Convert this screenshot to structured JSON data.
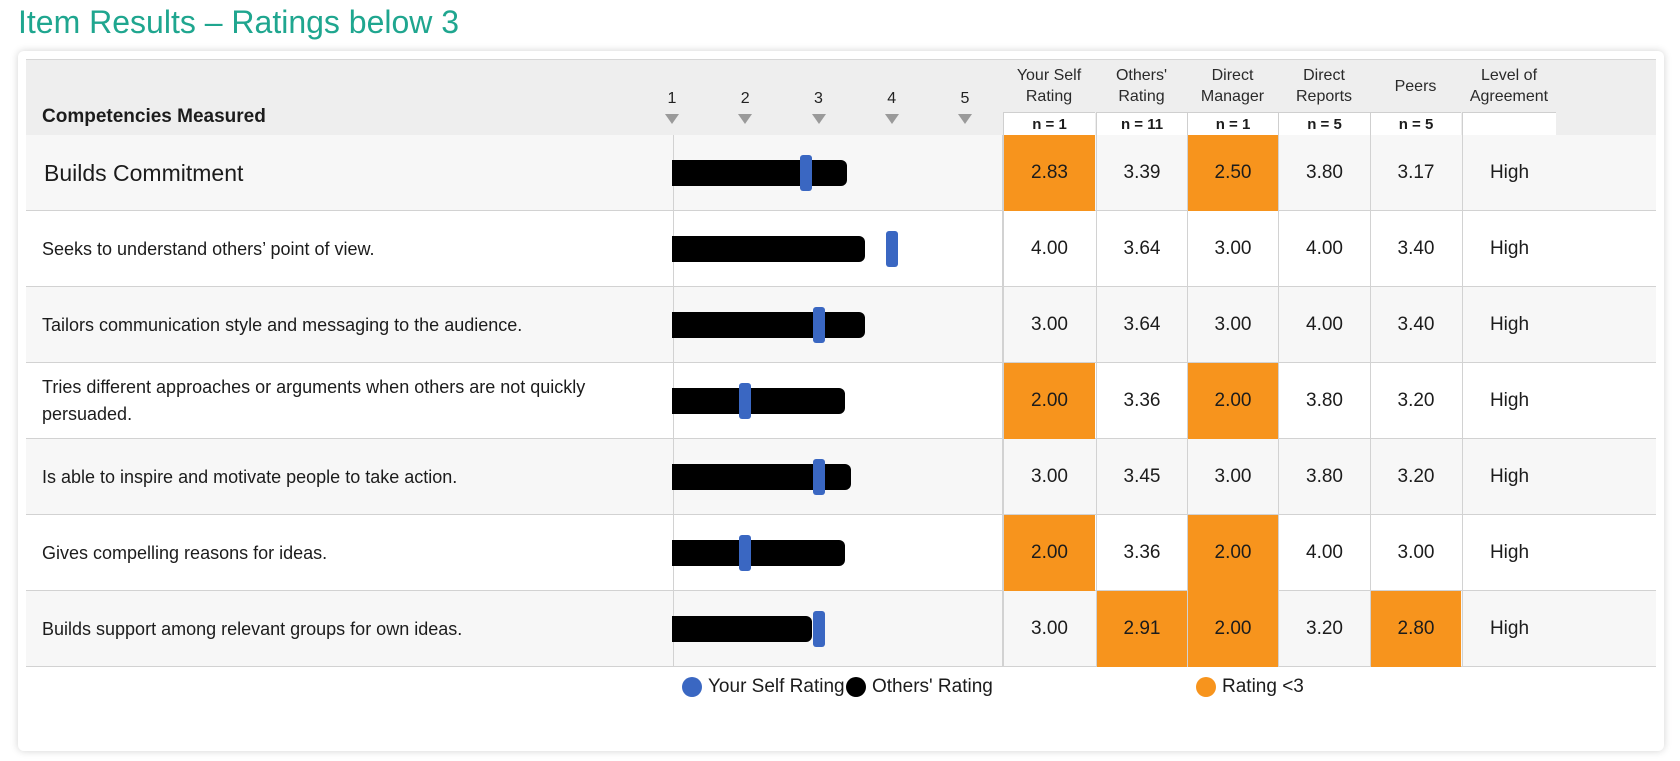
{
  "page": {
    "title": "Item Results – Ratings below 3"
  },
  "table": {
    "competency_header": "Competencies Measured",
    "scale": [
      "1",
      "2",
      "3",
      "4",
      "5"
    ],
    "columns": [
      {
        "key": "self",
        "label_lines": [
          "Your Self",
          "Rating"
        ],
        "n": "n = 1"
      },
      {
        "key": "others",
        "label_lines": [
          "Others'",
          "Rating"
        ],
        "n": "n = 11"
      },
      {
        "key": "manager",
        "label_lines": [
          "Direct",
          "Manager"
        ],
        "n": "n = 1"
      },
      {
        "key": "reports",
        "label_lines": [
          "Direct",
          "Reports"
        ],
        "n": "n = 5"
      },
      {
        "key": "peers",
        "label_lines": [
          "Peers"
        ],
        "n": "n = 5"
      },
      {
        "key": "agreement",
        "label_lines": [
          "Level of",
          "Agreement"
        ],
        "n": ""
      }
    ],
    "rows": [
      {
        "label": "Builds Commitment",
        "summary": true,
        "self": "2.83",
        "others": "3.39",
        "manager": "2.50",
        "reports": "3.80",
        "peers": "3.17",
        "agreement": "High"
      },
      {
        "label": "Seeks to understand others’ point of view.",
        "self": "4.00",
        "others": "3.64",
        "manager": "3.00",
        "reports": "4.00",
        "peers": "3.40",
        "agreement": "High"
      },
      {
        "label": "Tailors communication style and messaging to the audience.",
        "self": "3.00",
        "others": "3.64",
        "manager": "3.00",
        "reports": "4.00",
        "peers": "3.40",
        "agreement": "High"
      },
      {
        "label": "Tries different approaches or arguments when others are not quickly persuaded.",
        "self": "2.00",
        "others": "3.36",
        "manager": "2.00",
        "reports": "3.80",
        "peers": "3.20",
        "agreement": "High"
      },
      {
        "label": "Is able to inspire and motivate people to take action.",
        "self": "3.00",
        "others": "3.45",
        "manager": "3.00",
        "reports": "3.80",
        "peers": "3.20",
        "agreement": "High"
      },
      {
        "label": "Gives compelling reasons for ideas.",
        "self": "2.00",
        "others": "3.36",
        "manager": "2.00",
        "reports": "4.00",
        "peers": "3.00",
        "agreement": "High"
      },
      {
        "label": "Builds support among relevant groups for own ideas.",
        "self": "3.00",
        "others": "2.91",
        "manager": "2.00",
        "reports": "3.20",
        "peers": "2.80",
        "agreement": "High"
      }
    ]
  },
  "legend": {
    "self": "Your Self Rating",
    "others": "Others' Rating",
    "low": "Rating <3"
  },
  "colors": {
    "title": "#1fa68f",
    "self_marker": "#3a67c2",
    "others_bar": "#000000",
    "low_highlight": "#f7941d",
    "header_bg": "#eeeeee"
  },
  "chart_data": {
    "type": "bar",
    "orientation": "horizontal",
    "xlim": [
      1,
      5
    ],
    "x_ticks": [
      1,
      2,
      3,
      4,
      5
    ],
    "categories": [
      "Builds Commitment",
      "Seeks to understand others’ point of view.",
      "Tailors communication style and messaging to the audience.",
      "Tries different approaches or arguments when others are not quickly persuaded.",
      "Is able to inspire and motivate people to take action.",
      "Gives compelling reasons for ideas.",
      "Builds support among relevant groups for own ideas."
    ],
    "series": [
      {
        "name": "Others' Rating",
        "mark": "bar",
        "values": [
          3.39,
          3.64,
          3.64,
          3.36,
          3.45,
          3.36,
          2.91
        ]
      },
      {
        "name": "Your Self Rating",
        "mark": "marker",
        "values": [
          2.83,
          4.0,
          3.0,
          2.0,
          3.0,
          2.0,
          3.0
        ]
      }
    ],
    "highlight_threshold": 3
  }
}
